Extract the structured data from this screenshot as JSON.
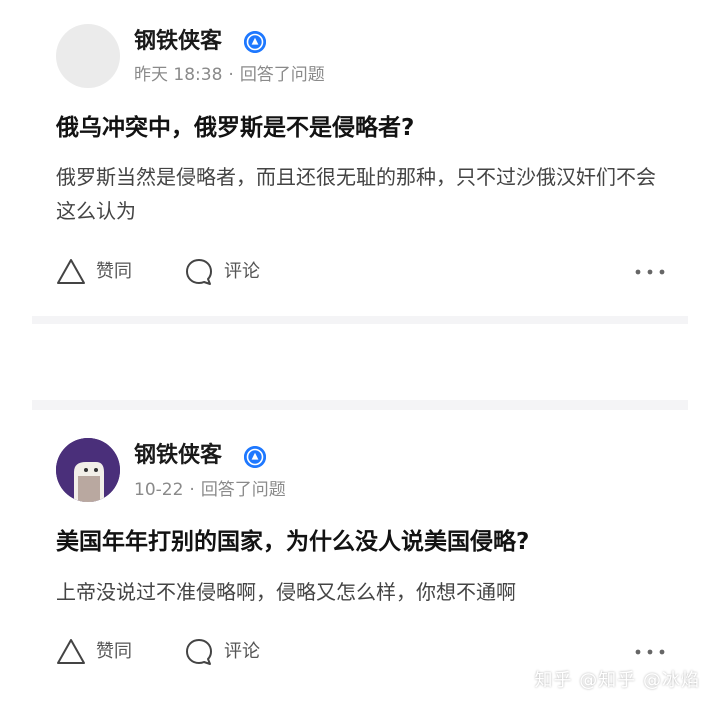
{
  "posts": [
    {
      "author": "钢铁侠客",
      "badge_icon": "verified-badge-icon",
      "time": "昨天 18:38",
      "separator": "·",
      "action_text": "回答了问题",
      "question": "俄乌冲突中，俄罗斯是不是侵略者?",
      "answer": "俄罗斯当然是侵略者，而且还很无耻的那种，只不过沙俄汉奸们不会这么认为",
      "actions": {
        "like": "赞同",
        "comment": "评论",
        "more": "···"
      }
    },
    {
      "author": "钢铁侠客",
      "badge_icon": "verified-badge-icon",
      "time": "10-22",
      "separator": "·",
      "action_text": "回答了问题",
      "question": "美国年年打别的国家，为什么没人说美国侵略?",
      "answer": "上帝没说过不准侵略啊，侵略又怎么样，你想不通啊",
      "actions": {
        "like": "赞同",
        "comment": "评论",
        "more": "···"
      }
    }
  ],
  "watermark": "知乎 @知乎 @冰焰",
  "colors": {
    "badge": "#1e78ff",
    "divider": "#f4f4f6",
    "meta": "#8a8a8a"
  }
}
